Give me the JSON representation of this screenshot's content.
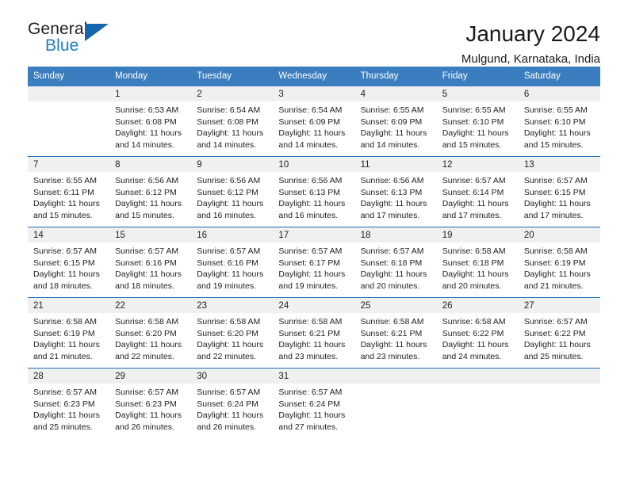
{
  "brand": {
    "word1": "General",
    "word2": "Blue",
    "triangle_color": "#1566ad",
    "blue_text_color": "#1b7fc4"
  },
  "header": {
    "title": "January 2024",
    "subtitle": "Mulgund, Karnataka, India"
  },
  "colors": {
    "header_row_bg": "#3a7ebf",
    "week_divider": "#1f6cb0",
    "day_number_strip": "#f0f0f0",
    "text": "#222222"
  },
  "calendar": {
    "weekday_headers": [
      "Sunday",
      "Monday",
      "Tuesday",
      "Wednesday",
      "Thursday",
      "Friday",
      "Saturday"
    ],
    "labels": {
      "sunrise": "Sunrise:",
      "sunset": "Sunset:",
      "daylight": "Daylight:"
    },
    "weeks": [
      [
        {
          "day": "",
          "sunrise": "",
          "sunset": "",
          "daylight": "",
          "empty": true
        },
        {
          "day": "1",
          "sunrise": "Sunrise: 6:53 AM",
          "sunset": "Sunset: 6:08 PM",
          "daylight": "Daylight: 11 hours and 14 minutes."
        },
        {
          "day": "2",
          "sunrise": "Sunrise: 6:54 AM",
          "sunset": "Sunset: 6:08 PM",
          "daylight": "Daylight: 11 hours and 14 minutes."
        },
        {
          "day": "3",
          "sunrise": "Sunrise: 6:54 AM",
          "sunset": "Sunset: 6:09 PM",
          "daylight": "Daylight: 11 hours and 14 minutes."
        },
        {
          "day": "4",
          "sunrise": "Sunrise: 6:55 AM",
          "sunset": "Sunset: 6:09 PM",
          "daylight": "Daylight: 11 hours and 14 minutes."
        },
        {
          "day": "5",
          "sunrise": "Sunrise: 6:55 AM",
          "sunset": "Sunset: 6:10 PM",
          "daylight": "Daylight: 11 hours and 15 minutes."
        },
        {
          "day": "6",
          "sunrise": "Sunrise: 6:55 AM",
          "sunset": "Sunset: 6:10 PM",
          "daylight": "Daylight: 11 hours and 15 minutes."
        }
      ],
      [
        {
          "day": "7",
          "sunrise": "Sunrise: 6:55 AM",
          "sunset": "Sunset: 6:11 PM",
          "daylight": "Daylight: 11 hours and 15 minutes."
        },
        {
          "day": "8",
          "sunrise": "Sunrise: 6:56 AM",
          "sunset": "Sunset: 6:12 PM",
          "daylight": "Daylight: 11 hours and 15 minutes."
        },
        {
          "day": "9",
          "sunrise": "Sunrise: 6:56 AM",
          "sunset": "Sunset: 6:12 PM",
          "daylight": "Daylight: 11 hours and 16 minutes."
        },
        {
          "day": "10",
          "sunrise": "Sunrise: 6:56 AM",
          "sunset": "Sunset: 6:13 PM",
          "daylight": "Daylight: 11 hours and 16 minutes."
        },
        {
          "day": "11",
          "sunrise": "Sunrise: 6:56 AM",
          "sunset": "Sunset: 6:13 PM",
          "daylight": "Daylight: 11 hours and 17 minutes."
        },
        {
          "day": "12",
          "sunrise": "Sunrise: 6:57 AM",
          "sunset": "Sunset: 6:14 PM",
          "daylight": "Daylight: 11 hours and 17 minutes."
        },
        {
          "day": "13",
          "sunrise": "Sunrise: 6:57 AM",
          "sunset": "Sunset: 6:15 PM",
          "daylight": "Daylight: 11 hours and 17 minutes."
        }
      ],
      [
        {
          "day": "14",
          "sunrise": "Sunrise: 6:57 AM",
          "sunset": "Sunset: 6:15 PM",
          "daylight": "Daylight: 11 hours and 18 minutes."
        },
        {
          "day": "15",
          "sunrise": "Sunrise: 6:57 AM",
          "sunset": "Sunset: 6:16 PM",
          "daylight": "Daylight: 11 hours and 18 minutes."
        },
        {
          "day": "16",
          "sunrise": "Sunrise: 6:57 AM",
          "sunset": "Sunset: 6:16 PM",
          "daylight": "Daylight: 11 hours and 19 minutes."
        },
        {
          "day": "17",
          "sunrise": "Sunrise: 6:57 AM",
          "sunset": "Sunset: 6:17 PM",
          "daylight": "Daylight: 11 hours and 19 minutes."
        },
        {
          "day": "18",
          "sunrise": "Sunrise: 6:57 AM",
          "sunset": "Sunset: 6:18 PM",
          "daylight": "Daylight: 11 hours and 20 minutes."
        },
        {
          "day": "19",
          "sunrise": "Sunrise: 6:58 AM",
          "sunset": "Sunset: 6:18 PM",
          "daylight": "Daylight: 11 hours and 20 minutes."
        },
        {
          "day": "20",
          "sunrise": "Sunrise: 6:58 AM",
          "sunset": "Sunset: 6:19 PM",
          "daylight": "Daylight: 11 hours and 21 minutes."
        }
      ],
      [
        {
          "day": "21",
          "sunrise": "Sunrise: 6:58 AM",
          "sunset": "Sunset: 6:19 PM",
          "daylight": "Daylight: 11 hours and 21 minutes."
        },
        {
          "day": "22",
          "sunrise": "Sunrise: 6:58 AM",
          "sunset": "Sunset: 6:20 PM",
          "daylight": "Daylight: 11 hours and 22 minutes."
        },
        {
          "day": "23",
          "sunrise": "Sunrise: 6:58 AM",
          "sunset": "Sunset: 6:20 PM",
          "daylight": "Daylight: 11 hours and 22 minutes."
        },
        {
          "day": "24",
          "sunrise": "Sunrise: 6:58 AM",
          "sunset": "Sunset: 6:21 PM",
          "daylight": "Daylight: 11 hours and 23 minutes."
        },
        {
          "day": "25",
          "sunrise": "Sunrise: 6:58 AM",
          "sunset": "Sunset: 6:21 PM",
          "daylight": "Daylight: 11 hours and 23 minutes."
        },
        {
          "day": "26",
          "sunrise": "Sunrise: 6:58 AM",
          "sunset": "Sunset: 6:22 PM",
          "daylight": "Daylight: 11 hours and 24 minutes."
        },
        {
          "day": "27",
          "sunrise": "Sunrise: 6:57 AM",
          "sunset": "Sunset: 6:22 PM",
          "daylight": "Daylight: 11 hours and 25 minutes."
        }
      ],
      [
        {
          "day": "28",
          "sunrise": "Sunrise: 6:57 AM",
          "sunset": "Sunset: 6:23 PM",
          "daylight": "Daylight: 11 hours and 25 minutes."
        },
        {
          "day": "29",
          "sunrise": "Sunrise: 6:57 AM",
          "sunset": "Sunset: 6:23 PM",
          "daylight": "Daylight: 11 hours and 26 minutes."
        },
        {
          "day": "30",
          "sunrise": "Sunrise: 6:57 AM",
          "sunset": "Sunset: 6:24 PM",
          "daylight": "Daylight: 11 hours and 26 minutes."
        },
        {
          "day": "31",
          "sunrise": "Sunrise: 6:57 AM",
          "sunset": "Sunset: 6:24 PM",
          "daylight": "Daylight: 11 hours and 27 minutes."
        },
        {
          "day": "",
          "sunrise": "",
          "sunset": "",
          "daylight": "",
          "empty": true
        },
        {
          "day": "",
          "sunrise": "",
          "sunset": "",
          "daylight": "",
          "empty": true
        },
        {
          "day": "",
          "sunrise": "",
          "sunset": "",
          "daylight": "",
          "empty": true
        }
      ]
    ]
  }
}
